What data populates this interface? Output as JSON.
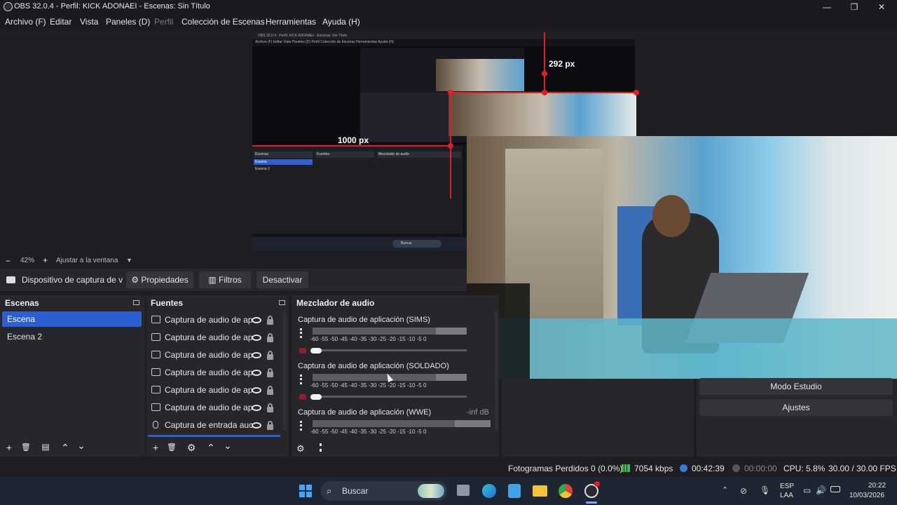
{
  "window": {
    "title": "OBS 32.0.4 - Perfil: KICK ADONAEI - Escenas: Sin Título",
    "minimize_glyph": "—",
    "maximize_glyph": "❐",
    "close_glyph": "✕"
  },
  "menu": {
    "items": [
      "Archivo (F)",
      "Editar",
      "Vista",
      "Paneles (D)",
      "Perfil",
      "Colección de Escenas",
      "Herramientas",
      "Ayuda (H)"
    ]
  },
  "preview": {
    "measure_vertical": "292 px",
    "measure_horizontal": "1000 px",
    "inner_title": "OBS 32.0.4 - Perfil: KICK ADONAEI - Escenas: Sin Título",
    "inner_menu": "Archivo (F)   Editar   Vista   Paneles (D)   Perfil   Colección de Escenas   Herramientas   Ayuda (H)",
    "inner_docks": {
      "scenes_header": "Escenas",
      "scenes": [
        "Escena",
        "Escena 2"
      ],
      "sources_header": "Fuentes",
      "mixer_header": "Mezclador de audio",
      "taskbar_search": "Buscar"
    },
    "colors": {
      "accent": "#e02020"
    }
  },
  "zoom": {
    "minus": "−",
    "value": "42%",
    "plus": "+",
    "fit_label": "Ajustar a la ventana",
    "dropdown_arrow": "▼"
  },
  "source_toolbar": {
    "device_label": "Dispositivo de captura de v",
    "properties": "Propiedades",
    "filters": "Filtros",
    "deactivate": "Desactivar"
  },
  "scenes": {
    "header": "Escenas",
    "items": [
      {
        "label": "Escena",
        "selected": true
      },
      {
        "label": "Escena 2",
        "selected": false
      }
    ],
    "footer": {
      "add": "+",
      "remove": "🗑",
      "filter": "▤",
      "up": "⌃",
      "down": "⌄"
    }
  },
  "sources": {
    "header": "Fuentes",
    "items": [
      {
        "label": "Captura de audio de ap",
        "icon": "app-audio-icon"
      },
      {
        "label": "Captura de audio de ap",
        "icon": "app-audio-icon"
      },
      {
        "label": "Captura de audio de ap",
        "icon": "app-audio-icon"
      },
      {
        "label": "Captura de audio de ap",
        "icon": "app-audio-icon"
      },
      {
        "label": "Captura de audio de ap",
        "icon": "app-audio-icon"
      },
      {
        "label": "Captura de audio de ap",
        "icon": "app-audio-icon"
      },
      {
        "label": "Captura de entrada auc",
        "icon": "microphone-icon"
      }
    ],
    "footer": {
      "add": "+",
      "remove": "🗑",
      "settings": "⚙",
      "up": "⌃",
      "down": "⌄"
    }
  },
  "mixer": {
    "header": "Mezclador de audio",
    "ticks": "-60  -55  -50  -45  -40  -35  -30  -25  -20  -15  -10   -5   0",
    "channels": [
      {
        "name": "Captura de audio de aplicación (SIMS)",
        "level": ""
      },
      {
        "name": "Captura de audio de aplicación (SOLDADO)",
        "level": ""
      },
      {
        "name": "Captura de audio de aplicación (WWE)",
        "level": "-inf dB"
      }
    ]
  },
  "controls": {
    "studio_mode": "Modo Estudio",
    "settings": "Ajustes"
  },
  "status": {
    "dropped_frames": "Fotogramas Perdidos 0 (0.0%)",
    "bitrate": "7054 kbps",
    "stream_time": "00:42:39",
    "record_time": "00:00:00",
    "cpu": "CPU: 5.8%",
    "fps": "30.00 / 30.00 FPS",
    "colors": {
      "bitrate": "#3fbf4f",
      "live": "#3a7bd5"
    }
  },
  "taskbar": {
    "search": "Buscar",
    "lang1": "ESP",
    "lang2": "LAA",
    "time": "20:22",
    "date": "10/03/2026"
  }
}
